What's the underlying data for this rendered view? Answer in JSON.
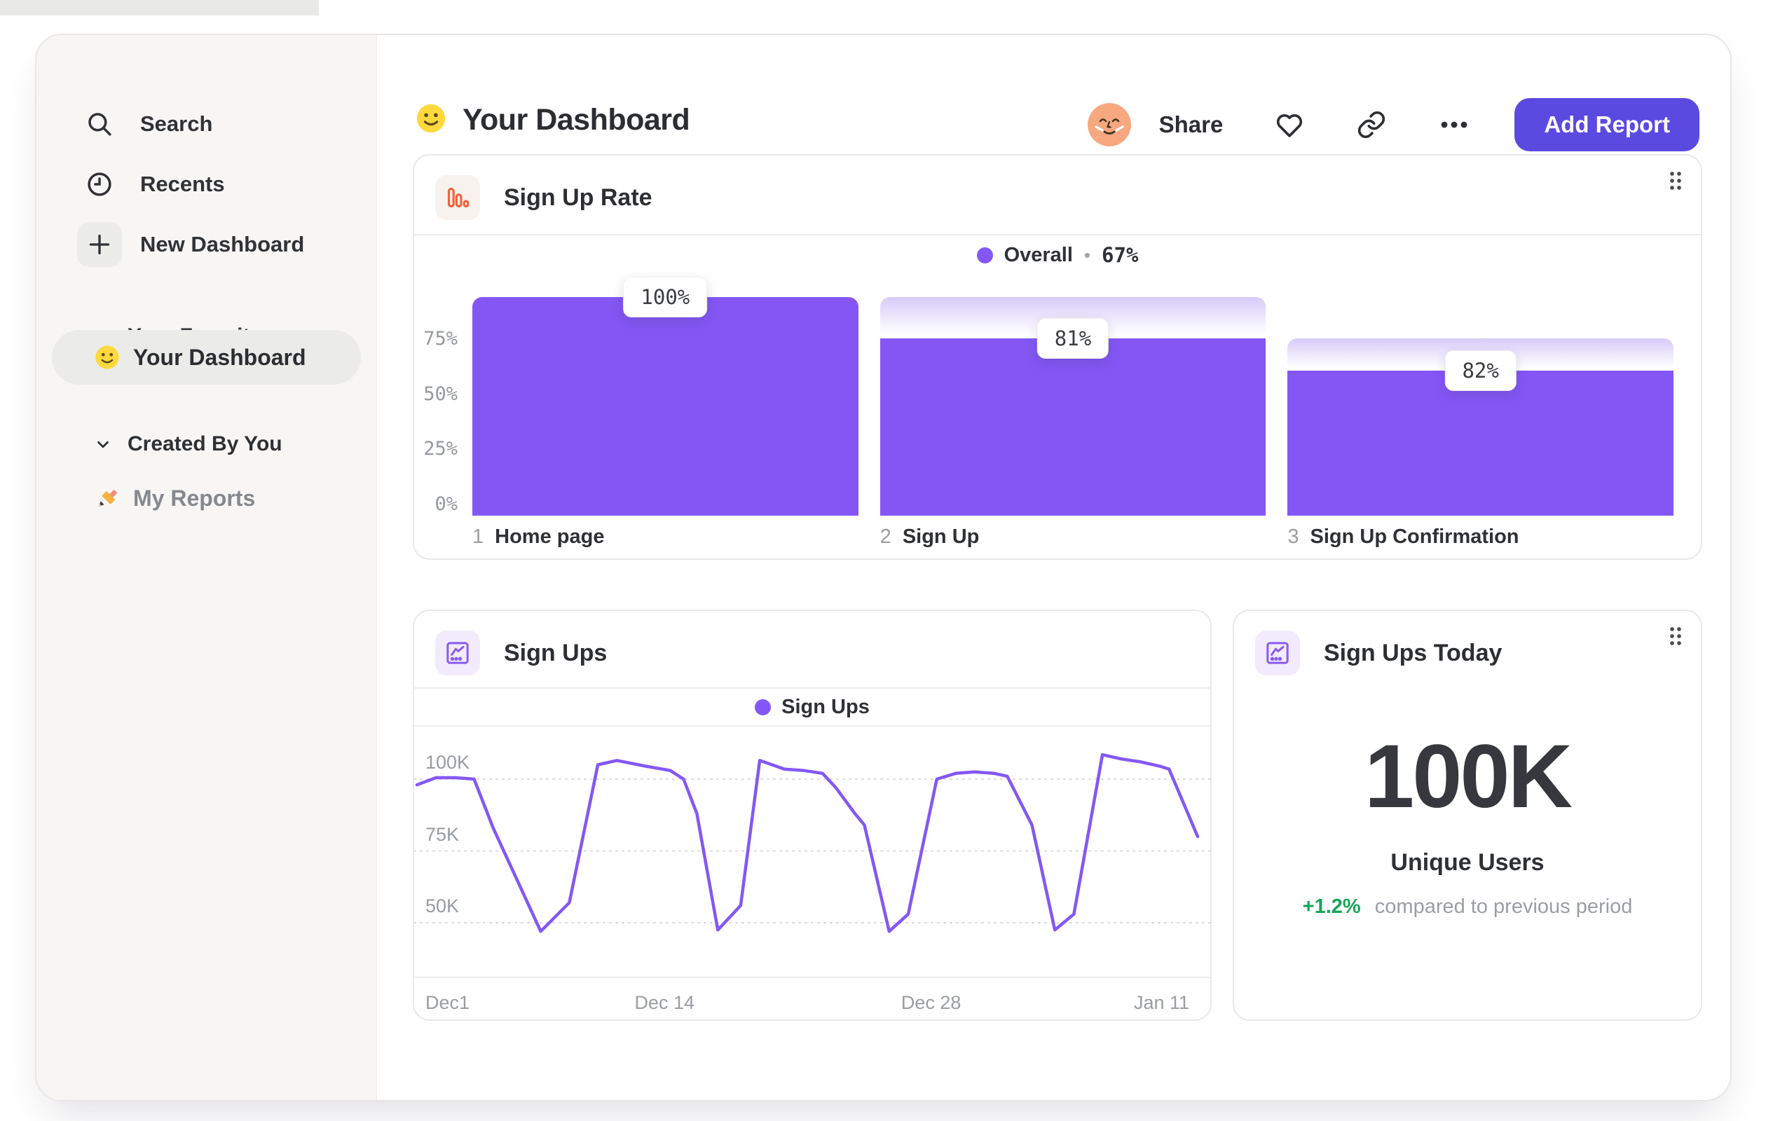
{
  "colors": {
    "purple": "#8457f5",
    "indigo_button": "#5a4ae0",
    "orange_icon": "#f1613c",
    "green_positive": "#16a45a",
    "ghost_gradient_top": "#d6cbf9",
    "sidebar_bg": "#f7f6f4",
    "selected_pill": "#ebebe9"
  },
  "sidebar": {
    "search": "Search",
    "recents": "Recents",
    "new_dashboard": "New Dashboard",
    "favorites_header": "Your Favorites",
    "favorite_item": "Your Dashboard",
    "created_header": "Created By You",
    "created_item": "My Reports"
  },
  "header": {
    "title": "Your Dashboard",
    "share": "Share",
    "add_report": "Add Report"
  },
  "cards": {
    "signup_rate": {
      "title": "Sign Up Rate"
    },
    "sign_ups": {
      "title": "Sign Ups"
    },
    "sign_ups_today": {
      "title": "Sign Ups Today",
      "value": "100K",
      "caption": "Unique Users",
      "delta": "+1.2%",
      "delta_caption": "compared to previous period"
    }
  },
  "chart_data": [
    {
      "type": "bar",
      "subtype": "funnel-steps",
      "title": "Sign Up Rate",
      "legend": {
        "label": "Overall",
        "separator": "•",
        "value": "67%"
      },
      "ylim": [
        0,
        100
      ],
      "y_ticks": [
        {
          "label": "75%",
          "pct": 75
        },
        {
          "label": "50%",
          "pct": 50
        },
        {
          "label": "25%",
          "pct": 25
        },
        {
          "label": "0%",
          "pct": 0
        }
      ],
      "steps": [
        {
          "index": "1",
          "label": "Home page",
          "conversion_label": "100%",
          "bar_pct": 100,
          "prev_pct": 100
        },
        {
          "index": "2",
          "label": "Sign Up",
          "conversion_label": "81%",
          "bar_pct": 81,
          "prev_pct": 100
        },
        {
          "index": "3",
          "label": "Sign Up Confirmation",
          "conversion_label": "82%",
          "bar_pct": 66.4,
          "prev_pct": 81
        }
      ]
    },
    {
      "type": "line",
      "title": "Sign Ups",
      "legend": "Sign Ups",
      "y_unit": "K",
      "ylim_k": [
        40,
        112
      ],
      "grid": "dashed-horizontal",
      "y_ticks": [
        {
          "label": "100K",
          "value": 100
        },
        {
          "label": "75K",
          "value": 75
        },
        {
          "label": "50K",
          "value": 50
        }
      ],
      "x_ticks": [
        {
          "label": "Dec1",
          "day": 0
        },
        {
          "label": "Dec 14",
          "day": 13
        },
        {
          "label": "Dec 28",
          "day": 27
        },
        {
          "label": "Jan 11",
          "day": 41
        }
      ],
      "x_range_days": [
        0,
        41
      ],
      "points": [
        [
          0,
          98
        ],
        [
          1,
          100.5
        ],
        [
          2,
          100.5
        ],
        [
          3,
          100
        ],
        [
          4,
          83
        ],
        [
          6.5,
          47
        ],
        [
          8,
          57
        ],
        [
          9.5,
          105
        ],
        [
          10.5,
          106.5
        ],
        [
          12,
          104.5
        ],
        [
          13.3,
          103
        ],
        [
          14,
          100
        ],
        [
          14.7,
          88
        ],
        [
          15.8,
          47.5
        ],
        [
          17,
          56
        ],
        [
          18,
          106.5
        ],
        [
          19.3,
          103.5
        ],
        [
          20.3,
          103
        ],
        [
          21.3,
          102
        ],
        [
          22,
          97
        ],
        [
          23,
          88
        ],
        [
          23.5,
          84
        ],
        [
          24.8,
          47
        ],
        [
          25.8,
          53
        ],
        [
          27.3,
          100
        ],
        [
          28.3,
          102
        ],
        [
          29.3,
          102.5
        ],
        [
          30.3,
          102
        ],
        [
          31,
          101
        ],
        [
          32.3,
          84
        ],
        [
          33.5,
          47.5
        ],
        [
          34.5,
          53
        ],
        [
          36,
          108.5
        ],
        [
          37,
          107
        ],
        [
          38,
          106
        ],
        [
          39,
          104.5
        ],
        [
          39.5,
          103.5
        ],
        [
          41,
          80
        ]
      ]
    }
  ]
}
